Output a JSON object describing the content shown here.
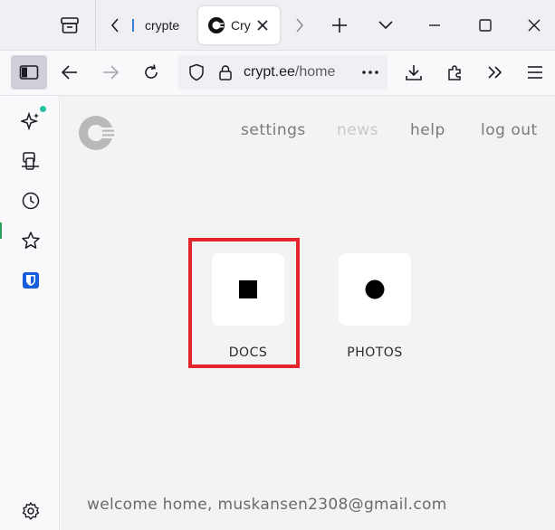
{
  "browser": {
    "tabs": [
      {
        "title": "crypte",
        "active": false
      },
      {
        "title": "Cryp",
        "active": true
      }
    ],
    "url_host": "crypt.ee",
    "url_path": "/home"
  },
  "app": {
    "nav": [
      {
        "label": "settings",
        "dimmed": false
      },
      {
        "label": "news",
        "dimmed": true
      },
      {
        "label": "help",
        "dimmed": false
      },
      {
        "label": "log out",
        "dimmed": false
      }
    ],
    "tiles": [
      {
        "label": "DOCS",
        "icon": "square-icon"
      },
      {
        "label": "PHOTOS",
        "icon": "circle-icon"
      }
    ],
    "welcome": "welcome home, muskansen2308@gmail.com"
  },
  "colors": {
    "highlight": "#e5242b",
    "sidebar_toggle_active": "#cfcfd8",
    "ai_dot": "#2ac3a2",
    "bitwarden": "#175ddc"
  }
}
